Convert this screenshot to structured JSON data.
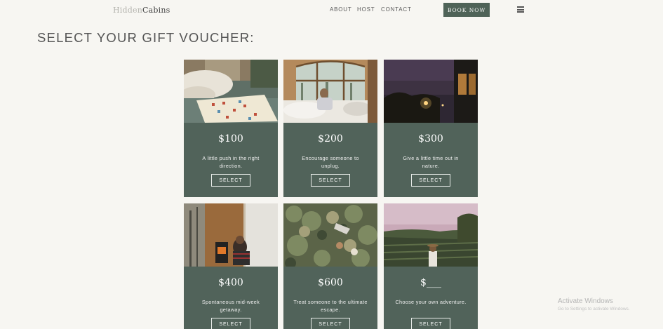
{
  "brand": {
    "part1": "Hidden",
    "part2": "Cabins"
  },
  "nav": {
    "about": "ABOUT",
    "host": "HOST",
    "contact": "CONTACT",
    "book": "BOOK NOW"
  },
  "page": {
    "title": "SELECT YOUR GIFT VOUCHER:"
  },
  "vouchers": [
    {
      "price": "$100",
      "desc": "A little push in the right direction.",
      "button": "SELECT"
    },
    {
      "price": "$200",
      "desc": "Encourage someone to unplug.",
      "button": "SELECT"
    },
    {
      "price": "$300",
      "desc": "Give a little time out in nature.",
      "button": "SELECT"
    },
    {
      "price": "$400",
      "desc": "Spontaneous mid-week getaway.",
      "button": "SELECT"
    },
    {
      "price": "$600",
      "desc": "Treat someone to the ultimate escape.",
      "button": "SELECT"
    },
    {
      "price": "$___",
      "desc": "Choose your own adventure.",
      "button": "SELECT"
    }
  ],
  "watermark": {
    "title": "Activate Windows",
    "subtitle": "Go to Settings to activate Windows."
  },
  "colors": {
    "background": "#f7f6f2",
    "card": "#51635a",
    "button": "#4f6358"
  }
}
